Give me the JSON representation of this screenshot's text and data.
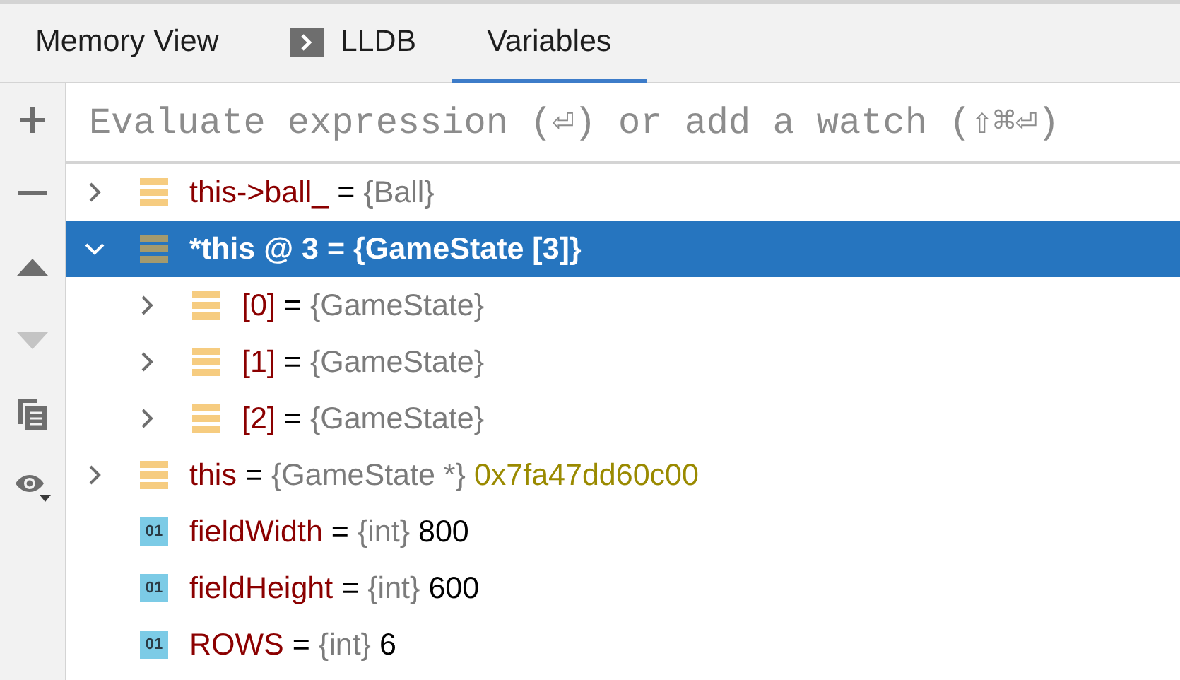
{
  "tabs": [
    {
      "label": "Memory View",
      "selected": false,
      "kind": "plain"
    },
    {
      "label": "LLDB",
      "selected": false,
      "kind": "console"
    },
    {
      "label": "Variables",
      "selected": true,
      "kind": "plain"
    }
  ],
  "toolbar": [
    {
      "kind": "add",
      "disabled": false
    },
    {
      "kind": "remove",
      "disabled": false
    },
    {
      "kind": "up",
      "disabled": false
    },
    {
      "kind": "down",
      "disabled": true
    },
    {
      "kind": "copy",
      "disabled": false
    },
    {
      "kind": "watch",
      "disabled": false
    }
  ],
  "expression": {
    "placeholder": "Evaluate expression (⏎) or add a watch (⇧⌘⏎)"
  },
  "variables": [
    {
      "kind": "object",
      "name": "this->ball_",
      "separator": "=",
      "type": "{Ball}",
      "expanded": false,
      "selected": false
    },
    {
      "kind": "object",
      "name": "*this @ 3",
      "separator": "=",
      "type": "{GameState [3]}",
      "expanded": true,
      "selected": true,
      "children": [
        {
          "kind": "object",
          "name": "[0]",
          "separator": "=",
          "type": "{GameState}",
          "expanded": false,
          "selected": false
        },
        {
          "kind": "object",
          "name": "[1]",
          "separator": "=",
          "type": "{GameState}",
          "expanded": false,
          "selected": false
        },
        {
          "kind": "object",
          "name": "[2]",
          "separator": "=",
          "type": "{GameState}",
          "expanded": false,
          "selected": false
        }
      ]
    },
    {
      "kind": "pointer",
      "name": "this",
      "separator": "=",
      "type": "{GameState *}",
      "value": "0x7fa47dd60c00",
      "expanded": false,
      "selected": false
    },
    {
      "kind": "primitive",
      "badge": "01",
      "name": "fieldWidth",
      "separator": "=",
      "type": "{int}",
      "value": "800",
      "selected": false
    },
    {
      "kind": "primitive",
      "badge": "01",
      "name": "fieldHeight",
      "separator": "=",
      "type": "{int}",
      "value": "600",
      "selected": false
    },
    {
      "kind": "primitive",
      "badge": "01",
      "name": "ROWS",
      "separator": "=",
      "type": "{int}",
      "value": "6",
      "selected": false
    }
  ]
}
